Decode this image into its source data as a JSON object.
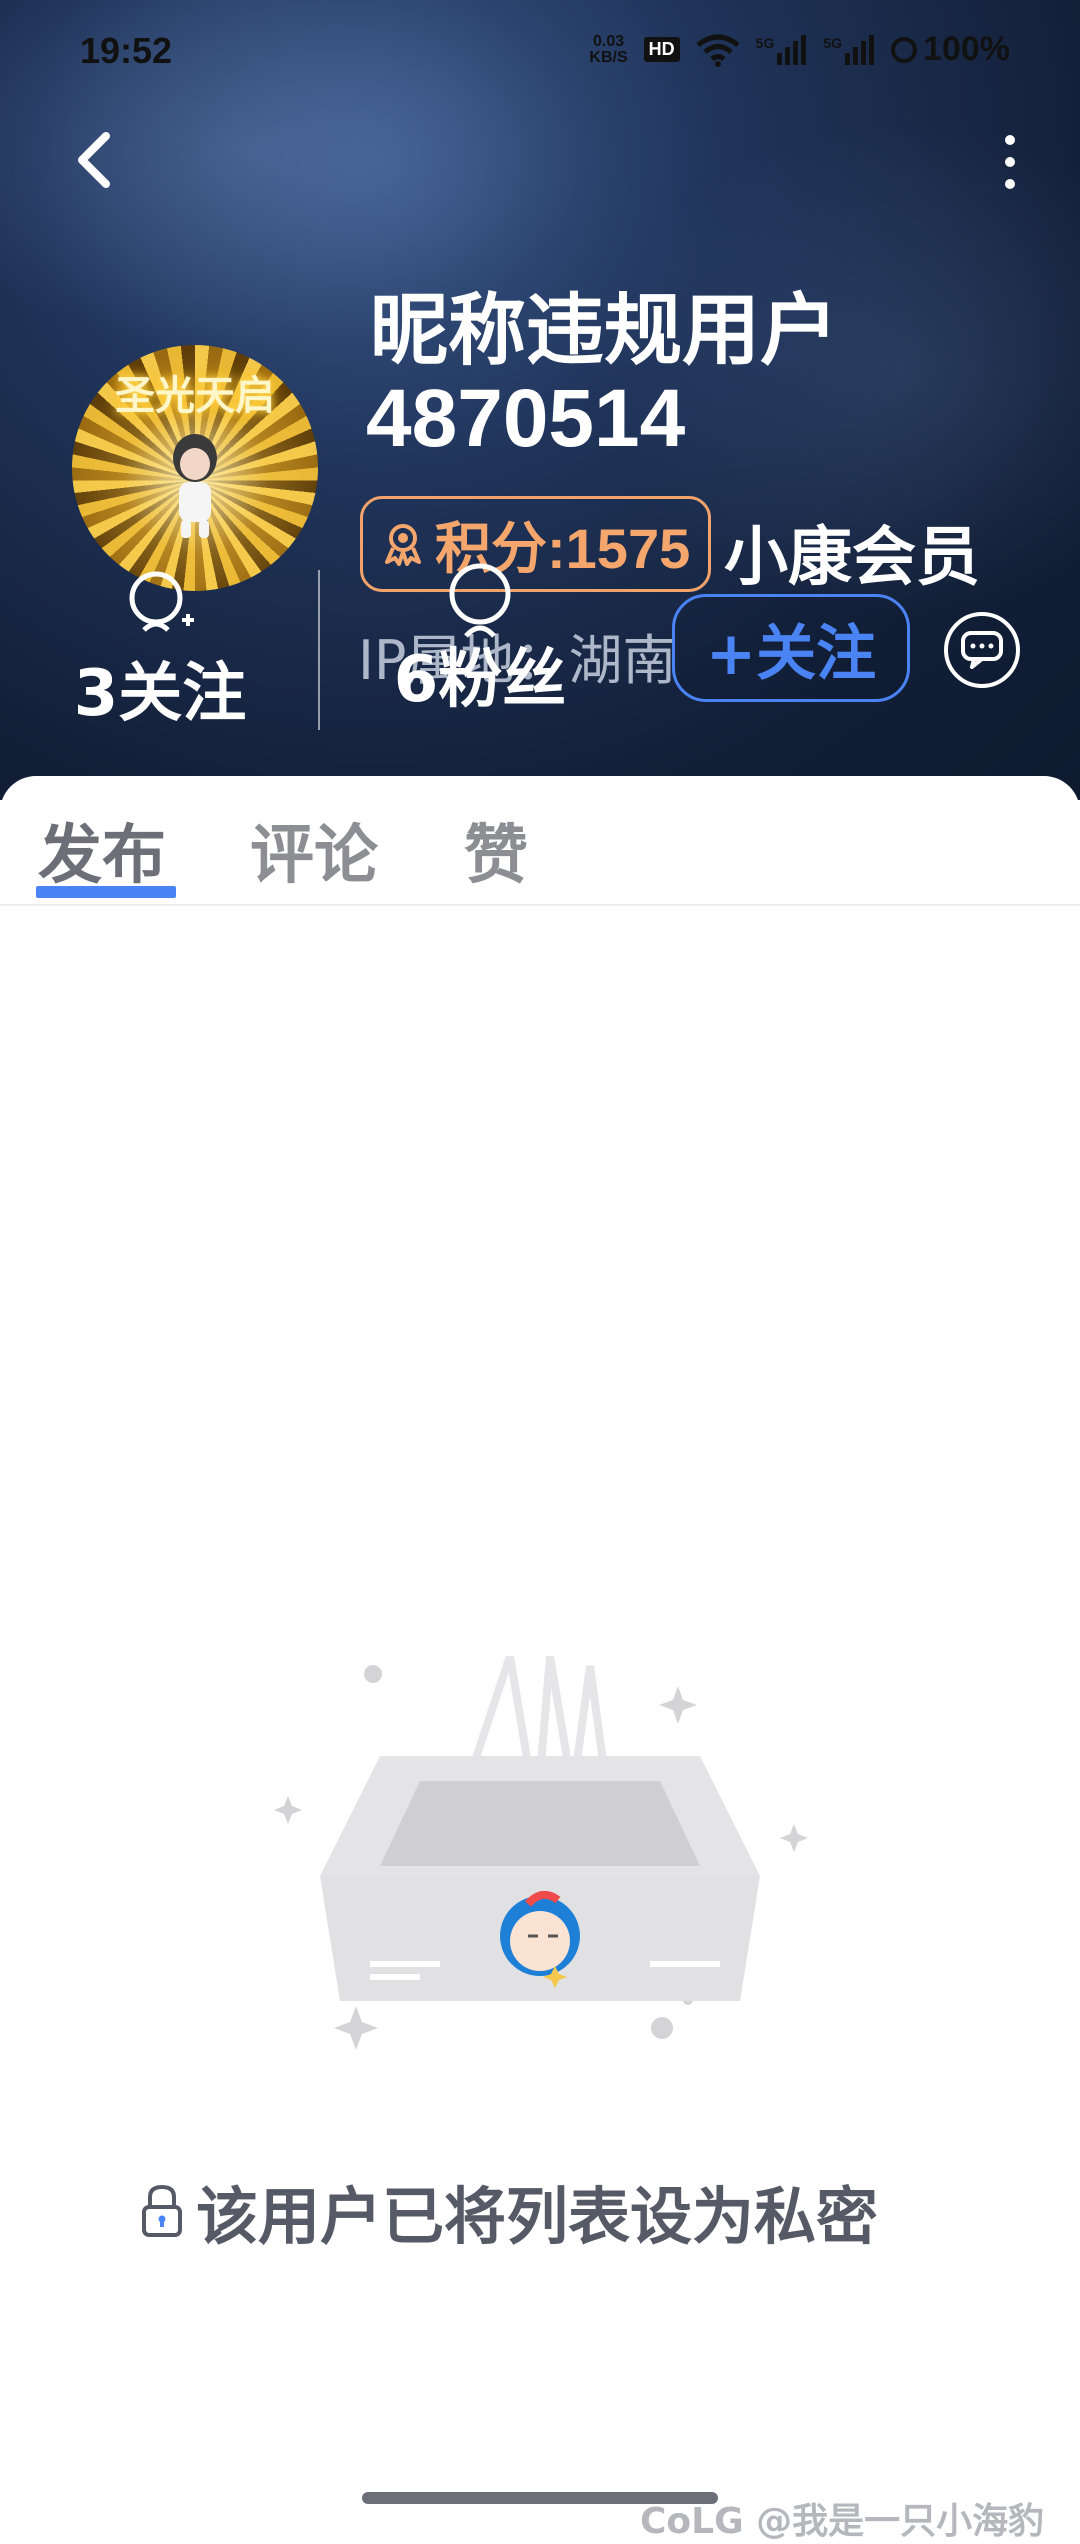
{
  "status_bar": {
    "time": "19:52",
    "net_speed_value": "0.03",
    "net_speed_unit": "KB/S",
    "hd_badge": "HD",
    "signal_1": "5G",
    "signal_2": "5G",
    "battery": "100%"
  },
  "profile": {
    "avatar_frame_text": "圣光天启",
    "nickname": "昵称违规用户",
    "uid": "4870514",
    "points_label": "积分:1575",
    "member_label": "小康会员",
    "ip_location": "IP属地：湖南",
    "following": "3关注",
    "fans": "6粉丝",
    "follow_button": "+关注"
  },
  "tabs": [
    {
      "label": "发布",
      "active": true
    },
    {
      "label": "评论",
      "active": false
    },
    {
      "label": "赞",
      "active": false
    }
  ],
  "empty_state": {
    "message": "该用户已将列表设为私密"
  },
  "watermark": "CoLG @我是一只小海豹",
  "colors": {
    "accent": "#4a84f4",
    "points": "#f5a66d",
    "header_bg": "#1a2b4c"
  }
}
